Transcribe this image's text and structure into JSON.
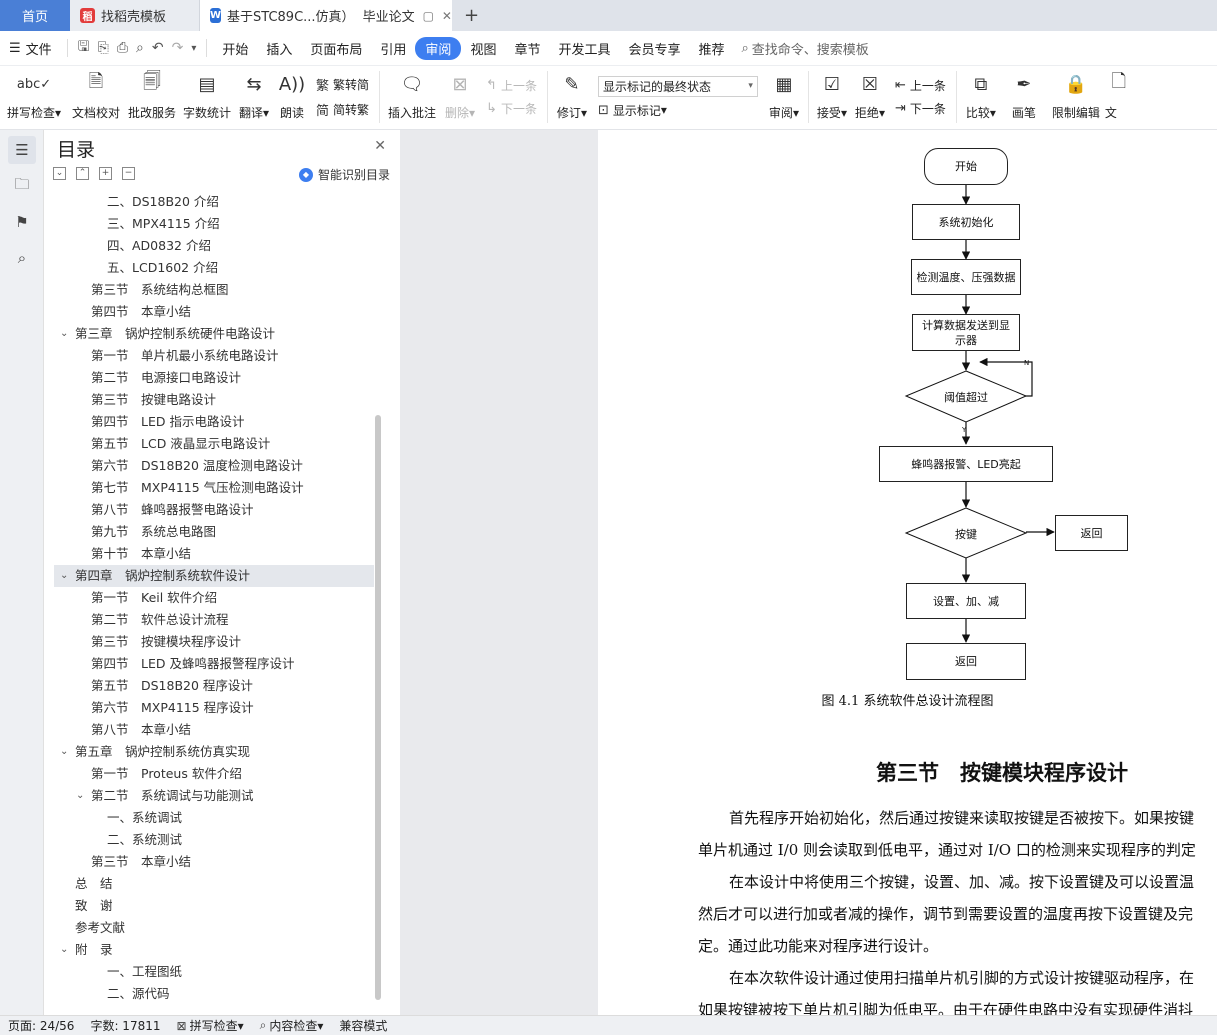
{
  "tabs": {
    "home": "首页",
    "t1": "找稻壳模板",
    "t2": "基于STC89C...仿真）",
    "t2_badge": "毕业论文",
    "add": "+"
  },
  "menu": {
    "file": "文件",
    "items": [
      "开始",
      "插入",
      "页面布局",
      "引用",
      "审阅",
      "视图",
      "章节",
      "开发工具",
      "会员专享",
      "推荐"
    ],
    "search": "查找命令、搜索模板"
  },
  "ribbon": {
    "spell": "拼写检查",
    "proof": "文档校对",
    "batch": "批改服务",
    "wordcount": "字数统计",
    "translate": "翻译",
    "read": "朗读",
    "trad": "繁转简",
    "simp": "简转繁",
    "insert_comment": "插入批注",
    "delete": "删除",
    "prev": "上一条",
    "next": "下一条",
    "revise": "修订",
    "markup_state": "显示标记的最终状态",
    "show_markup": "显示标记",
    "review": "审阅",
    "accept": "接受",
    "reject": "拒绝",
    "prev2": "上一条",
    "next2": "下一条",
    "compare": "比较",
    "pen": "画笔",
    "restrict": "限制编辑",
    "doc_cut": "文"
  },
  "toc": {
    "title": "目录",
    "smart": "智能识别目录",
    "items": [
      {
        "text": "二、DS18B20 介绍",
        "level": 3
      },
      {
        "text": "三、MPX4115 介绍",
        "level": 3
      },
      {
        "text": "四、AD0832 介绍",
        "level": 3
      },
      {
        "text": "五、LCD1602 介绍",
        "level": 3
      },
      {
        "text": "第三节　系统结构总框图",
        "level": 2
      },
      {
        "text": "第四节　本章小结",
        "level": 2
      },
      {
        "text": "第三章　锅炉控制系统硬件电路设计",
        "level": 1,
        "arrow": true
      },
      {
        "text": "第一节　单片机最小系统电路设计",
        "level": 2
      },
      {
        "text": "第二节　电源接口电路设计",
        "level": 2
      },
      {
        "text": "第三节　按键电路设计",
        "level": 2
      },
      {
        "text": "第四节　LED 指示电路设计",
        "level": 2
      },
      {
        "text": "第五节　LCD 液晶显示电路设计",
        "level": 2
      },
      {
        "text": "第六节　DS18B20 温度检测电路设计",
        "level": 2
      },
      {
        "text": "第七节　MXP4115 气压检测电路设计",
        "level": 2
      },
      {
        "text": "第八节　蜂鸣器报警电路设计",
        "level": 2
      },
      {
        "text": "第九节　系统总电路图",
        "level": 2
      },
      {
        "text": "第十节　本章小结",
        "level": 2
      },
      {
        "text": "第四章　锅炉控制系统软件设计",
        "level": 1,
        "arrow": true,
        "selected": true
      },
      {
        "text": "第一节　Keil 软件介绍",
        "level": 2
      },
      {
        "text": "第二节　软件总设计流程",
        "level": 2
      },
      {
        "text": "第三节　按键模块程序设计",
        "level": 2
      },
      {
        "text": "第四节　LED 及蜂鸣器报警程序设计",
        "level": 2
      },
      {
        "text": "第五节　DS18B20 程序设计",
        "level": 2
      },
      {
        "text": "第六节　MXP4115 程序设计",
        "level": 2
      },
      {
        "text": "第八节　本章小结",
        "level": 2
      },
      {
        "text": "第五章　锅炉控制系统仿真实现",
        "level": 1,
        "arrow": true
      },
      {
        "text": "第一节　Proteus 软件介绍",
        "level": 2
      },
      {
        "text": "第二节　系统调试与功能测试",
        "level": 2,
        "arrow": true
      },
      {
        "text": "一、系统调试",
        "level": 3
      },
      {
        "text": "二、系统测试",
        "level": 3
      },
      {
        "text": "第三节　本章小结",
        "level": 2
      },
      {
        "text": "总　结",
        "level": 1
      },
      {
        "text": "致　谢",
        "level": 1
      },
      {
        "text": "参考文献",
        "level": 1
      },
      {
        "text": "附　录",
        "level": 1,
        "arrow": true
      },
      {
        "text": "一、工程图纸",
        "level": 3
      },
      {
        "text": "二、源代码",
        "level": 3
      }
    ]
  },
  "flow": {
    "start": "开始",
    "init": "系统初始化",
    "detect": "检测温度、压强数据",
    "send": "计算数据发送到显示器",
    "threshold": "阈值超过",
    "n_label": "N",
    "y_label": "Y",
    "alarm": "蜂鸣器报警、LED亮起",
    "key": "按键",
    "ret_right": "返回",
    "set": "设置、加、减",
    "ret_bottom": "返回"
  },
  "figure_caption": "图 4.1  系统软件总设计流程图",
  "section_title": "第三节　按键模块程序设计",
  "body_lines": [
    {
      "text": "首先程序开始初始化，然后通过按键来读取按键是否被按下。如果按键",
      "indent": true
    },
    {
      "text": "单片机通过 I/0 则会读取到低电平，通过对 I/O 口的检测来实现程序的判定",
      "indent": false
    },
    {
      "text": "在本设计中将使用三个按键，设置、加、减。按下设置键及可以设置温",
      "indent": true
    },
    {
      "text": "然后才可以进行加或者减的操作，调节到需要设置的温度再按下设置键及完",
      "indent": false
    },
    {
      "text": "定。通过此功能来对程序进行设计。",
      "indent": false
    },
    {
      "text": "在本次软件设计通过使用扫描单片机引脚的方式设计按键驱动程序，在",
      "indent": true
    },
    {
      "text": "如果按键被按下单片机引脚为低电平。由于在硬件电路中没有实现硬件消抖",
      "indent": false
    }
  ],
  "status": {
    "page": "页面: 24/56",
    "words": "字数: 17811",
    "spell": "拼写检查",
    "content": "内容检查",
    "compat": "兼容模式"
  },
  "colors": {
    "accent": "#3d7ef0",
    "home_tab": "#4a7fd6",
    "docer": "#e23b3b",
    "wps_word": "#2b6fd6"
  }
}
